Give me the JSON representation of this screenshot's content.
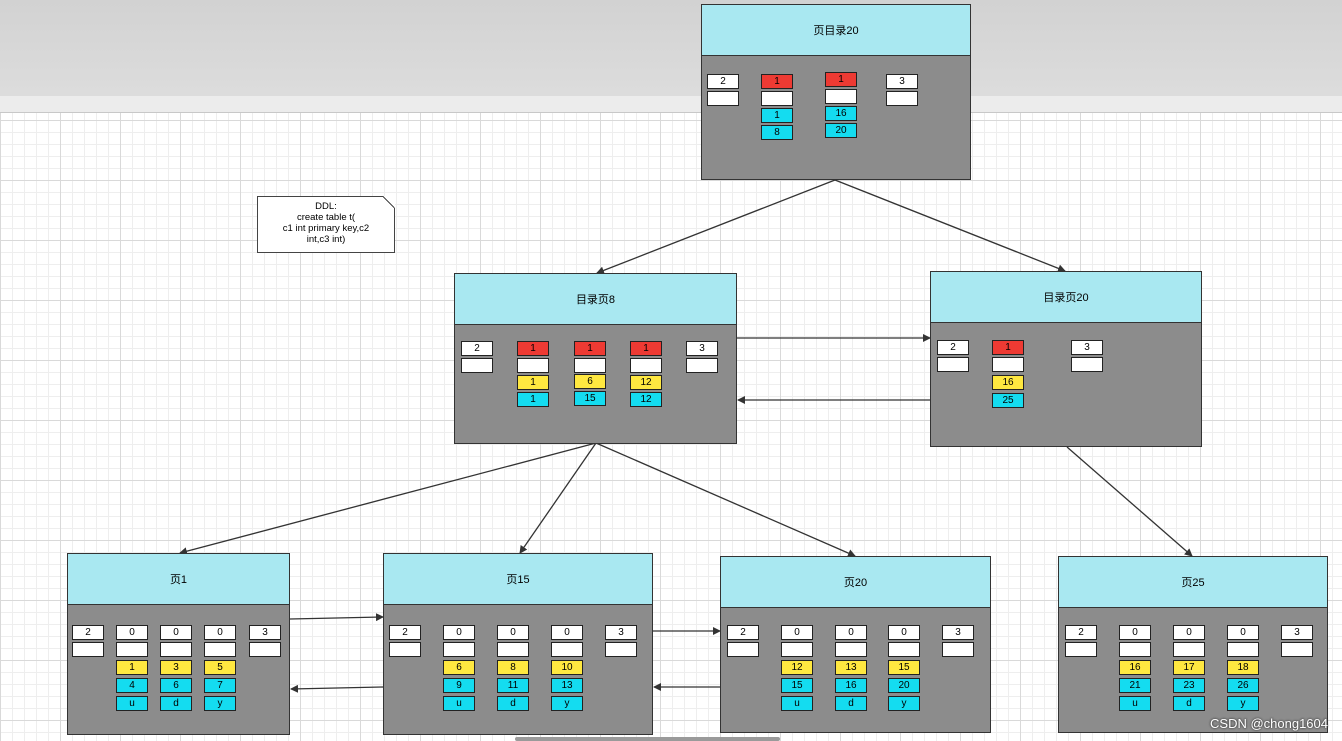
{
  "top_page": {
    "title": "页目录20",
    "infimum": "2",
    "supremum": "3",
    "records": [
      {
        "type": "1",
        "c1": "1",
        "c2": "8"
      },
      {
        "type": "1",
        "c1": "16",
        "c2": "20"
      }
    ]
  },
  "note": {
    "lines": [
      "DDL:",
      "create table t(",
      "c1 int primary key,c2",
      "int,c3 int)"
    ]
  },
  "dir_left": {
    "title": "目录页8",
    "infimum": "2",
    "supremum": "3",
    "records": [
      {
        "type": "1",
        "c1": "1",
        "c2": "1"
      },
      {
        "type": "1",
        "c1": "6",
        "c2": "15"
      },
      {
        "type": "1",
        "c1": "12",
        "c2": "12"
      }
    ]
  },
  "dir_right": {
    "title": "目录页20",
    "infimum": "2",
    "supremum": "3",
    "records": [
      {
        "type": "1",
        "c1": "16",
        "c2": "25"
      }
    ]
  },
  "leaf1": {
    "title": "页1",
    "infimum": "2",
    "supremum": "3",
    "records": [
      {
        "type": "0",
        "c1": "1",
        "c2": "4",
        "c3": "u"
      },
      {
        "type": "0",
        "c1": "3",
        "c2": "6",
        "c3": "d"
      },
      {
        "type": "0",
        "c1": "5",
        "c2": "7",
        "c3": "y"
      }
    ]
  },
  "leaf15": {
    "title": "页15",
    "infimum": "2",
    "supremum": "3",
    "records": [
      {
        "type": "0",
        "c1": "6",
        "c2": "9",
        "c3": "u"
      },
      {
        "type": "0",
        "c1": "8",
        "c2": "11",
        "c3": "d"
      },
      {
        "type": "0",
        "c1": "10",
        "c2": "13",
        "c3": "y"
      }
    ]
  },
  "leaf20": {
    "title": "页20",
    "infimum": "2",
    "supremum": "3",
    "records": [
      {
        "type": "0",
        "c1": "12",
        "c2": "15",
        "c3": "u"
      },
      {
        "type": "0",
        "c1": "13",
        "c2": "16",
        "c3": "d"
      },
      {
        "type": "0",
        "c1": "15",
        "c2": "20",
        "c3": "y"
      }
    ]
  },
  "leaf25": {
    "title": "页25",
    "infimum": "2",
    "supremum": "3",
    "records": [
      {
        "type": "0",
        "c1": "16",
        "c2": "21",
        "c3": "u"
      },
      {
        "type": "0",
        "c1": "17",
        "c2": "23",
        "c3": "d"
      },
      {
        "type": "0",
        "c1": "18",
        "c2": "26",
        "c3": "y"
      }
    ]
  },
  "watermark": "CSDN @chong1604"
}
